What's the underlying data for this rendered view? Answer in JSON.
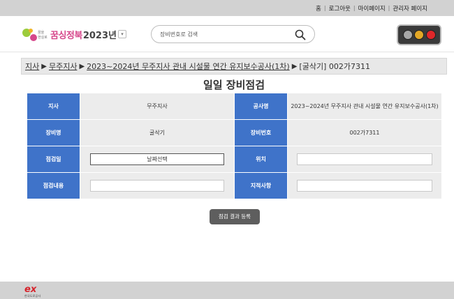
{
  "topbar": {
    "links": [
      "홈",
      "로그아웃",
      "마이페이지",
      "관리자 페이지"
    ]
  },
  "header": {
    "logo_brand": "꿈싱정북",
    "logo_year": "2023년",
    "search_placeholder": "장비번호로 검색",
    "traffic_colors": [
      "#a7a7a7",
      "#e3a726",
      "#e0272a"
    ]
  },
  "breadcrumb": {
    "items": [
      "지사",
      "무주지사",
      "2023~2024년 무주지사 관내 시설물 연간 유지보수공사(1차)"
    ],
    "current": "[굴삭기] 002가7311"
  },
  "page_title": "일일 장비점검",
  "form": {
    "branch_label": "지사",
    "branch_value": "무주지사",
    "project_label": "공사명",
    "project_value": "2023~2024년 무주지사 관내 시설물 연간 유지보수공사(1차)",
    "equip_name_label": "장비명",
    "equip_name_value": "굴삭기",
    "equip_no_label": "장비번호",
    "equip_no_value": "002가7311",
    "date_label": "점검일",
    "date_button": "날짜선택",
    "location_label": "위치",
    "content_label": "점검내용",
    "note_label": "지적사항"
  },
  "submit_label": "점검 결과 등록",
  "footer": {
    "logo_text": "한국도로공사"
  }
}
